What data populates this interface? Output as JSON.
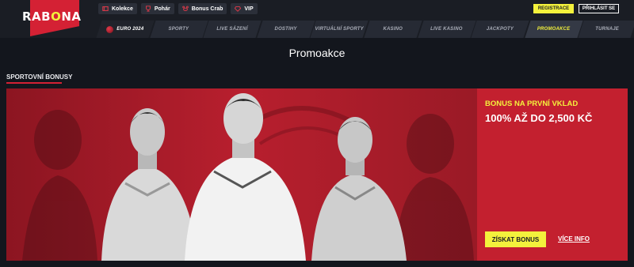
{
  "brand": {
    "logo_text_start": "RAB",
    "logo_text_o": "O",
    "logo_text_end": "NA",
    "accent_color": "#d42134",
    "highlight_color": "#f3f13c"
  },
  "top_links": [
    {
      "label": "Kolekce",
      "icon": "collection-icon"
    },
    {
      "label": "Pohár",
      "icon": "trophy-icon"
    },
    {
      "label": "Bonus Crab",
      "icon": "crab-icon"
    },
    {
      "label": "VIP",
      "icon": "diamond-icon"
    }
  ],
  "auth": {
    "register_label": "REGISTRACE",
    "login_label": "PŘIHLÁSIT SE"
  },
  "nav": {
    "items": [
      {
        "label": "EURO 2024"
      },
      {
        "label": "SPORTY"
      },
      {
        "label": "LIVE SÁZENÍ"
      },
      {
        "label": "DOSTIHY"
      },
      {
        "label": "VIRTUÁLNÍ SPORTY"
      },
      {
        "label": "KASINO"
      },
      {
        "label": "LIVE KASINO"
      },
      {
        "label": "JACKPOTY"
      },
      {
        "label": "PROMOAKCE"
      },
      {
        "label": "TURNAJE"
      }
    ],
    "active": "PROMOAKCE"
  },
  "page": {
    "title": "Promoakce",
    "section_title": "SPORTOVNÍ BONUSY"
  },
  "banner": {
    "subtitle": "BONUS NA PRVNÍ VKLAD",
    "headline": "100% AŽ DO 2,500 KČ",
    "claim_label": "ZÍSKAT BONUS",
    "more_info_label": "VÍCE INFO"
  }
}
